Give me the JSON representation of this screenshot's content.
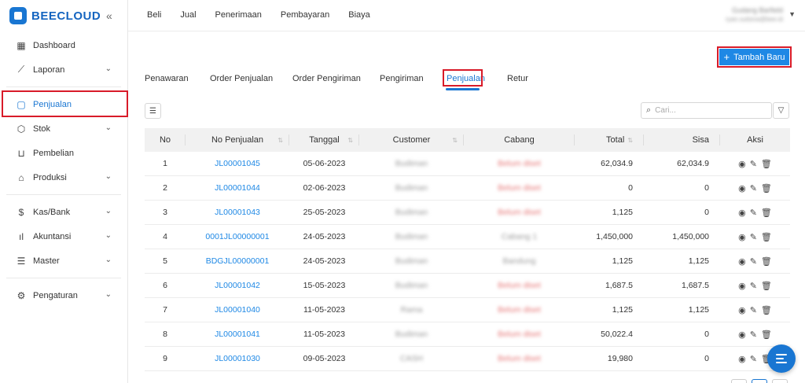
{
  "app": {
    "brand": "BEECLOUD"
  },
  "sidebar": {
    "items": [
      {
        "label": "Dashboard",
        "icon": "grid-icon",
        "chevron": false
      },
      {
        "label": "Laporan",
        "icon": "chart-icon",
        "chevron": true
      },
      {
        "label": "Penjualan",
        "icon": "cart-box-icon",
        "chevron": false,
        "active": true
      },
      {
        "label": "Stok",
        "icon": "cube-icon",
        "chevron": true
      },
      {
        "label": "Pembelian",
        "icon": "shopping-cart-icon",
        "chevron": false
      },
      {
        "label": "Produksi",
        "icon": "factory-icon",
        "chevron": true
      },
      {
        "label": "Kas/Bank",
        "icon": "dollar-icon",
        "chevron": true
      },
      {
        "label": "Akuntansi",
        "icon": "bar-icon",
        "chevron": true
      },
      {
        "label": "Master",
        "icon": "database-icon",
        "chevron": true
      },
      {
        "label": "Pengaturan",
        "icon": "gear-icon",
        "chevron": true
      }
    ]
  },
  "topbar": {
    "menu": [
      "Beli",
      "Jual",
      "Penerimaan",
      "Pembayaran",
      "Biaya"
    ],
    "user_name": "Gudang Barfield",
    "user_email": "ryan.sutisna@bee.id"
  },
  "toolbar": {
    "add_label": "Tambah Baru",
    "search_placeholder": "Cari..."
  },
  "tabs": [
    {
      "label": "Penawaran"
    },
    {
      "label": "Order Penjualan"
    },
    {
      "label": "Order Pengiriman"
    },
    {
      "label": "Pengiriman"
    },
    {
      "label": "Penjualan",
      "active": true
    },
    {
      "label": "Retur"
    }
  ],
  "table": {
    "columns": [
      "No",
      "No Penjualan",
      "Tanggal",
      "Customer",
      "Cabang",
      "Total",
      "Sisa",
      "Aksi"
    ],
    "rows": [
      {
        "no": "1",
        "doc": "JL00001045",
        "date": "05-06-2023",
        "customer": "Budiman",
        "branch": "Belum diset",
        "total": "62,034.9",
        "rest": "62,034.9"
      },
      {
        "no": "2",
        "doc": "JL00001044",
        "date": "02-06-2023",
        "customer": "Budiman",
        "branch": "Belum diset",
        "total": "0",
        "rest": "0"
      },
      {
        "no": "3",
        "doc": "JL00001043",
        "date": "25-05-2023",
        "customer": "Budiman",
        "branch": "Belum diset",
        "total": "1,125",
        "rest": "0"
      },
      {
        "no": "4",
        "doc": "0001JL00000001",
        "date": "24-05-2023",
        "customer": "Budiman",
        "branch": "Cabang 1",
        "total": "1,450,000",
        "rest": "1,450,000"
      },
      {
        "no": "5",
        "doc": "BDGJL00000001",
        "date": "24-05-2023",
        "customer": "Budiman",
        "branch": "Bandung",
        "total": "1,125",
        "rest": "1,125"
      },
      {
        "no": "6",
        "doc": "JL00001042",
        "date": "15-05-2023",
        "customer": "Budiman",
        "branch": "Belum diset",
        "total": "1,687.5",
        "rest": "1,687.5"
      },
      {
        "no": "7",
        "doc": "JL00001040",
        "date": "11-05-2023",
        "customer": "Rama",
        "branch": "Belum diset",
        "total": "1,125",
        "rest": "1,125"
      },
      {
        "no": "8",
        "doc": "JL00001041",
        "date": "11-05-2023",
        "customer": "Budiman",
        "branch": "Belum diset",
        "total": "50,022.4",
        "rest": "0"
      },
      {
        "no": "9",
        "doc": "JL00001030",
        "date": "09-05-2023",
        "customer": "CASH",
        "branch": "Belum diset",
        "total": "19,980",
        "rest": "0"
      }
    ]
  },
  "colors": {
    "accent": "#1976d2",
    "highlight": "#d81b29",
    "header_bg": "#f1f1f1"
  }
}
